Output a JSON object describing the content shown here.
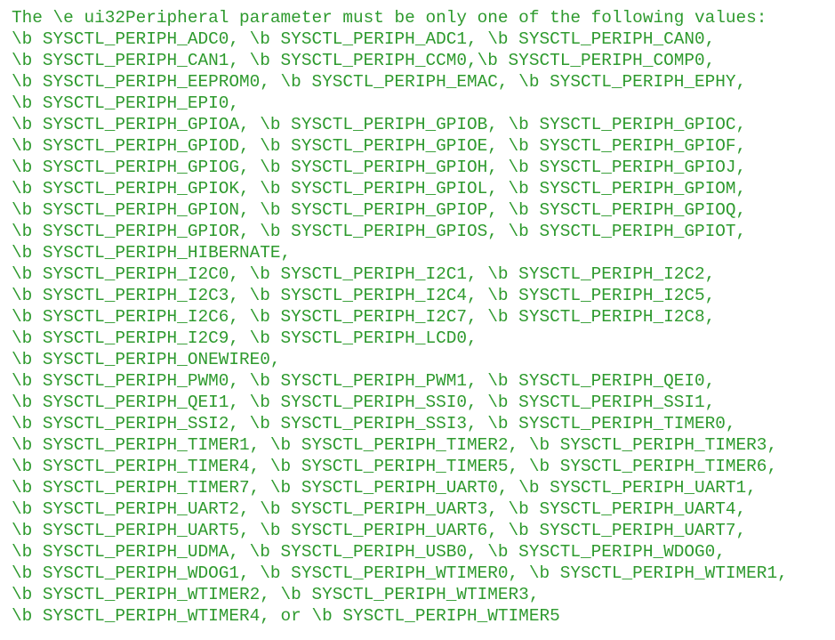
{
  "theme": {
    "background": "#ffffff",
    "comment_color": "#2e9a2e"
  },
  "code_view": {
    "lines": [
      "The \\e ui32Peripheral parameter must be only one of the following values:",
      "\\b SYSCTL_PERIPH_ADC0, \\b SYSCTL_PERIPH_ADC1, \\b SYSCTL_PERIPH_CAN0,",
      "\\b SYSCTL_PERIPH_CAN1, \\b SYSCTL_PERIPH_CCM0,\\b SYSCTL_PERIPH_COMP0,",
      "\\b SYSCTL_PERIPH_EEPROM0, \\b SYSCTL_PERIPH_EMAC, \\b SYSCTL_PERIPH_EPHY,",
      "\\b SYSCTL_PERIPH_EPI0,",
      "\\b SYSCTL_PERIPH_GPIOA, \\b SYSCTL_PERIPH_GPIOB, \\b SYSCTL_PERIPH_GPIOC,",
      "\\b SYSCTL_PERIPH_GPIOD, \\b SYSCTL_PERIPH_GPIOE, \\b SYSCTL_PERIPH_GPIOF,",
      "\\b SYSCTL_PERIPH_GPIOG, \\b SYSCTL_PERIPH_GPIOH, \\b SYSCTL_PERIPH_GPIOJ,",
      "\\b SYSCTL_PERIPH_GPIOK, \\b SYSCTL_PERIPH_GPIOL, \\b SYSCTL_PERIPH_GPIOM,",
      "\\b SYSCTL_PERIPH_GPION, \\b SYSCTL_PERIPH_GPIOP, \\b SYSCTL_PERIPH_GPIOQ,",
      "\\b SYSCTL_PERIPH_GPIOR, \\b SYSCTL_PERIPH_GPIOS, \\b SYSCTL_PERIPH_GPIOT,",
      "\\b SYSCTL_PERIPH_HIBERNATE,",
      "\\b SYSCTL_PERIPH_I2C0, \\b SYSCTL_PERIPH_I2C1, \\b SYSCTL_PERIPH_I2C2,",
      "\\b SYSCTL_PERIPH_I2C3, \\b SYSCTL_PERIPH_I2C4, \\b SYSCTL_PERIPH_I2C5,",
      "\\b SYSCTL_PERIPH_I2C6, \\b SYSCTL_PERIPH_I2C7, \\b SYSCTL_PERIPH_I2C8,",
      "\\b SYSCTL_PERIPH_I2C9, \\b SYSCTL_PERIPH_LCD0,",
      "\\b SYSCTL_PERIPH_ONEWIRE0,",
      "\\b SYSCTL_PERIPH_PWM0, \\b SYSCTL_PERIPH_PWM1, \\b SYSCTL_PERIPH_QEI0,",
      "\\b SYSCTL_PERIPH_QEI1, \\b SYSCTL_PERIPH_SSI0, \\b SYSCTL_PERIPH_SSI1,",
      "\\b SYSCTL_PERIPH_SSI2, \\b SYSCTL_PERIPH_SSI3, \\b SYSCTL_PERIPH_TIMER0,",
      "\\b SYSCTL_PERIPH_TIMER1, \\b SYSCTL_PERIPH_TIMER2, \\b SYSCTL_PERIPH_TIMER3,",
      "\\b SYSCTL_PERIPH_TIMER4, \\b SYSCTL_PERIPH_TIMER5, \\b SYSCTL_PERIPH_TIMER6,",
      "\\b SYSCTL_PERIPH_TIMER7, \\b SYSCTL_PERIPH_UART0, \\b SYSCTL_PERIPH_UART1,",
      "\\b SYSCTL_PERIPH_UART2, \\b SYSCTL_PERIPH_UART3, \\b SYSCTL_PERIPH_UART4,",
      "\\b SYSCTL_PERIPH_UART5, \\b SYSCTL_PERIPH_UART6, \\b SYSCTL_PERIPH_UART7,",
      "\\b SYSCTL_PERIPH_UDMA, \\b SYSCTL_PERIPH_USB0, \\b SYSCTL_PERIPH_WDOG0,",
      "\\b SYSCTL_PERIPH_WDOG1, \\b SYSCTL_PERIPH_WTIMER0, \\b SYSCTL_PERIPH_WTIMER1,",
      "\\b SYSCTL_PERIPH_WTIMER2, \\b SYSCTL_PERIPH_WTIMER3,",
      "\\b SYSCTL_PERIPH_WTIMER4, or \\b SYSCTL_PERIPH_WTIMER5"
    ]
  }
}
